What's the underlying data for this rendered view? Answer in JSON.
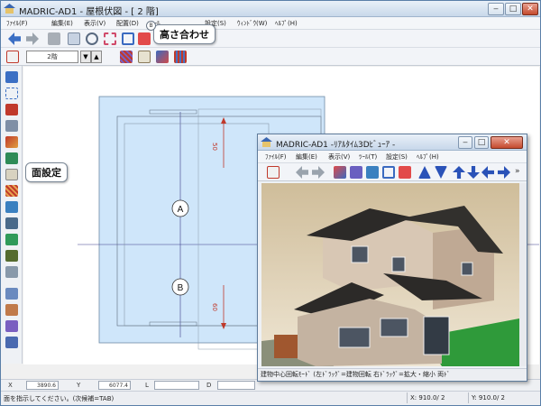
{
  "app": {
    "title": "MADRIC-AD1 - 屋根伏図 - [ 2 階]",
    "window_buttons": [
      "‒",
      "□",
      "✕"
    ]
  },
  "menu": [
    {
      "label": "ﾌｧｲﾙ(F)"
    },
    {
      "label": "編集(E)"
    },
    {
      "label": "表示(V)"
    },
    {
      "label": "配置(D)"
    },
    {
      "label": "ﾂｰﾙ"
    },
    {
      "label": "設定(S)"
    },
    {
      "label": "ｳｨﾝﾄﾞｳ(W)"
    },
    {
      "label": "ﾍﾙﾌﾟ(H)"
    }
  ],
  "toolbar2": {
    "floor_value": "2階",
    "dropdown_glyph": "▼",
    "up_glyph": "▲"
  },
  "callouts": {
    "height_align": {
      "label": "高さ合わせ",
      "marker": "B"
    },
    "face_setting": {
      "label": "面設定"
    }
  },
  "plan": {
    "point_a": "A",
    "point_b": "B",
    "dim_top": "50",
    "dim_bottom": "60"
  },
  "coordinates": {
    "x_label": "X",
    "x_value": "3890.6",
    "y_label": "Y",
    "y_value": "6077.4",
    "l_label": "L",
    "l_value": "",
    "d_label": "D",
    "d_value": ""
  },
  "status": {
    "message": "面を指示してください。(次候補=TAB)",
    "x_readout": "X: 910.0/ 2",
    "y_readout": "Y: 910.0/ 2"
  },
  "viewer": {
    "title": "MADRIC-AD1 -ﾘｱﾙﾀｲﾑ3Dﾋﾞｭｰｱ -",
    "menu": [
      {
        "label": "ﾌｧｲﾙ(F)"
      },
      {
        "label": "編集(E)"
      },
      {
        "label": "表示(V)"
      },
      {
        "label": "ﾂｰﾙ(T)"
      },
      {
        "label": "設定(S)"
      },
      {
        "label": "ﾍﾙﾌﾟ(H)"
      }
    ],
    "status": "建物中心回転ﾓｰﾄﾞ (左ﾄﾞﾗｯｸﾞ=建物回転 右ﾄﾞﾗｯｸﾞ=拡大・縮小 両ﾄﾞ",
    "more_glyph": "»"
  }
}
